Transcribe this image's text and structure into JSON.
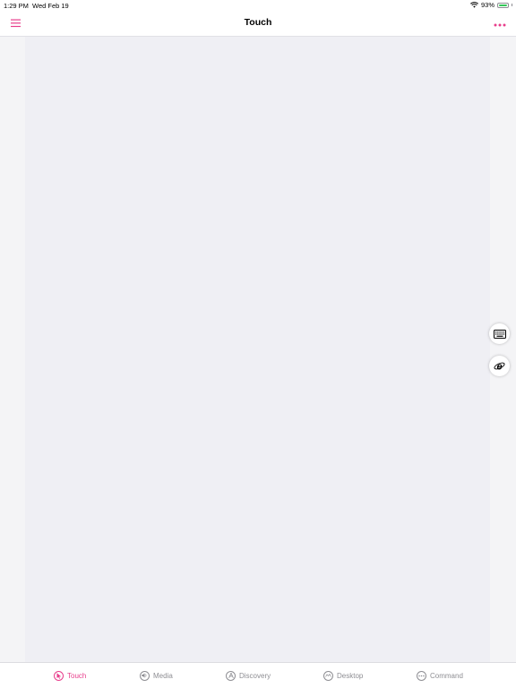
{
  "status": {
    "time": "1:29 PM",
    "date": "Wed Feb 19",
    "battery": "93%",
    "battery_level": 0.93
  },
  "nav": {
    "title": "Touch",
    "menu_icon": "hamburger-menu-icon",
    "more_icon": "more-dots-icon"
  },
  "floating_buttons": {
    "keyboard_icon": "keyboard-icon",
    "browser_icon": "internet-explorer-icon"
  },
  "tabs": [
    {
      "label": "Touch",
      "icon": "cursor-icon",
      "active": true
    },
    {
      "label": "Media",
      "icon": "speaker-icon",
      "active": false
    },
    {
      "label": "Discovery",
      "icon": "letter-a-icon",
      "active": false
    },
    {
      "label": "Desktop",
      "icon": "desktop-icon",
      "active": false
    },
    {
      "label": "Command",
      "icon": "ellipsis-icon",
      "active": false
    }
  ],
  "colors": {
    "accent": "#e83e8c",
    "touchpad_bg": "#efeff4",
    "inactive": "#8e8e93"
  }
}
